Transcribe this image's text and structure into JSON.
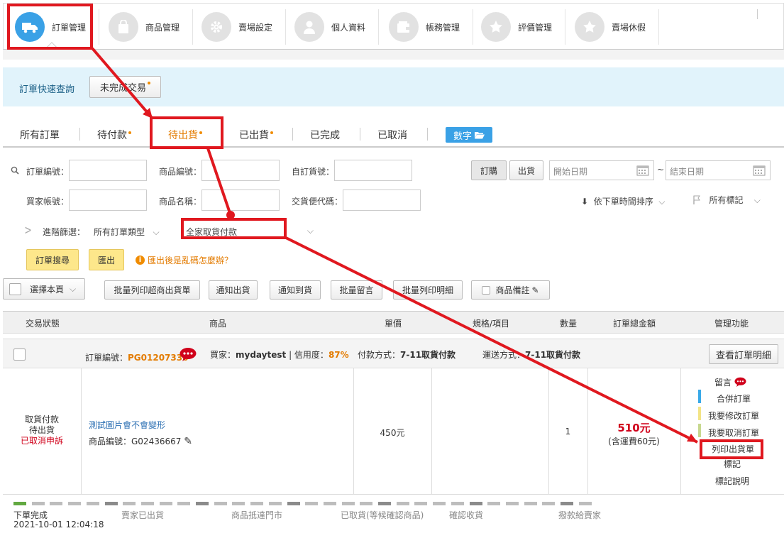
{
  "nav": {
    "items": [
      {
        "label": "訂單管理",
        "icon": "truck-icon",
        "active": true
      },
      {
        "label": "商品管理",
        "icon": "shopping-bag-icon",
        "active": false
      },
      {
        "label": "賣場設定",
        "icon": "gear-icon",
        "active": false
      },
      {
        "label": "個人資料",
        "icon": "user-icon",
        "active": false
      },
      {
        "label": "帳務管理",
        "icon": "wallet-icon",
        "active": false
      },
      {
        "label": "評價管理",
        "icon": "star-icon",
        "active": false
      },
      {
        "label": "賣場休假",
        "icon": "star-icon",
        "active": false
      }
    ]
  },
  "quick": {
    "label": "訂單快速查詢",
    "button": "未完成交易"
  },
  "tabs": {
    "items": [
      "所有訂單",
      "待付款",
      "待出貨",
      "已出貨",
      "已完成",
      "已取消"
    ],
    "number_button": "數字"
  },
  "filter": {
    "order_no_label": "訂單編號：",
    "product_no_label": "商品編號：",
    "custom_no_label": "自訂貨號：",
    "buyer_label": "買家帳號：",
    "product_name_label": "商品名稱：",
    "cvs_code_label": "交貨便代碼：",
    "seg_order": "訂購",
    "seg_ship": "出貨",
    "start_date_placeholder": "開始日期",
    "date_sep": "~",
    "end_date_placeholder": "結束日期",
    "sort_label": "依下單時間排序",
    "mark_label": "所有標記",
    "advanced_label": "進階篩選：",
    "order_type": "所有訂單類型",
    "payment_type": "全家取貨付款",
    "search_button": "訂單搜尋",
    "export_button": "匯出",
    "help_text": "匯出後是亂碼怎麼辦？"
  },
  "toolbar": {
    "select_page": "選擇本頁",
    "buttons": [
      "批量列印超商出貨單",
      "通知出貨",
      "通知到貨",
      "批量留言",
      "批量列印明細"
    ],
    "product_note": "商品備註"
  },
  "table": {
    "headers": [
      "交易狀態",
      "商品",
      "單價",
      "規格/項目",
      "數量",
      "訂單總金額",
      "管理功能"
    ]
  },
  "order": {
    "order_no_label": "訂單編號：",
    "order_no": "PG01207336",
    "buyer_label": "買家：",
    "buyer": "mydaytest",
    "credit_label": " | 信用度：",
    "credit": "87%",
    "payment_label": "付款方式：",
    "payment": "7-11取貨付款",
    "shipping_label": "運送方式：",
    "shipping": "7-11取貨付款",
    "detail_button": "查看訂單明細",
    "status_lines": [
      "取貨付款",
      "待出貨"
    ],
    "status_alert": "已取消申訴",
    "product_name": "測試圖片會不會變形",
    "product_code": "商品編號：G02436667",
    "price": "450元",
    "quantity": "1",
    "total": "510元",
    "shipping_fee": "(含運費60元)",
    "actions": [
      "留言",
      "合併訂單",
      "我要修改訂單",
      "我要取消訂單",
      "列印出貨單",
      "標記",
      "標記說明"
    ],
    "action_bar_colors": [
      "",
      "#39a9e8",
      "#f3e486",
      "#c7d88f",
      "",
      "",
      ""
    ]
  },
  "progress": {
    "steps": [
      "下單完成",
      "賣家已出貨",
      "商品抵達門市",
      "已取貨(等候確認商品)",
      "確認收貨",
      "撥款給賣家"
    ],
    "timestamp": "2021-10-01 12:04:18"
  },
  "colors": {
    "accent": "#3aa1e6",
    "highlight_red": "#e0181f",
    "orange": "#e37b00",
    "price_red": "#d0021b"
  }
}
